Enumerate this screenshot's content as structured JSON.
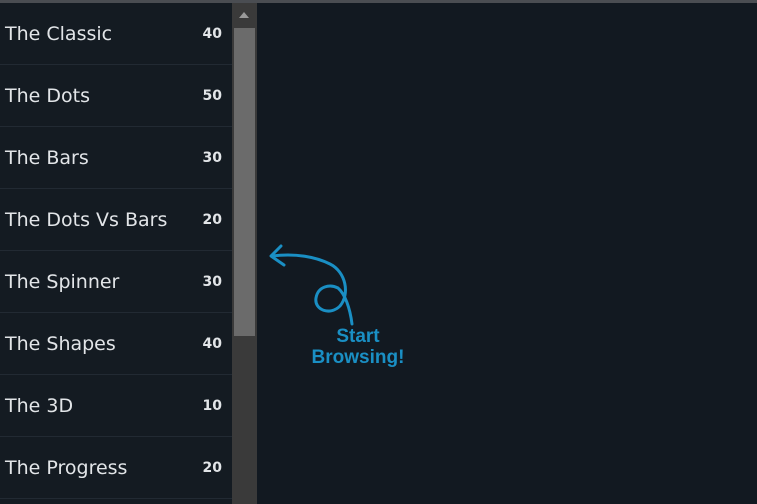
{
  "list": {
    "items": [
      {
        "label": "The Classic",
        "count": "40"
      },
      {
        "label": "The Dots",
        "count": "50"
      },
      {
        "label": "The Bars",
        "count": "30"
      },
      {
        "label": "The Dots Vs Bars",
        "count": "20"
      },
      {
        "label": "The Spinner",
        "count": "30"
      },
      {
        "label": "The Shapes",
        "count": "40"
      },
      {
        "label": "The 3D",
        "count": "10"
      },
      {
        "label": "The Progress",
        "count": "20"
      }
    ]
  },
  "hint": {
    "line1": "Start",
    "line2": "Browsing!",
    "icon": "curly-arrow-icon"
  },
  "colors": {
    "background": "#121921",
    "sidebar": "#141b22",
    "accent": "#1a8fc4",
    "text": "#e2e5e8"
  }
}
